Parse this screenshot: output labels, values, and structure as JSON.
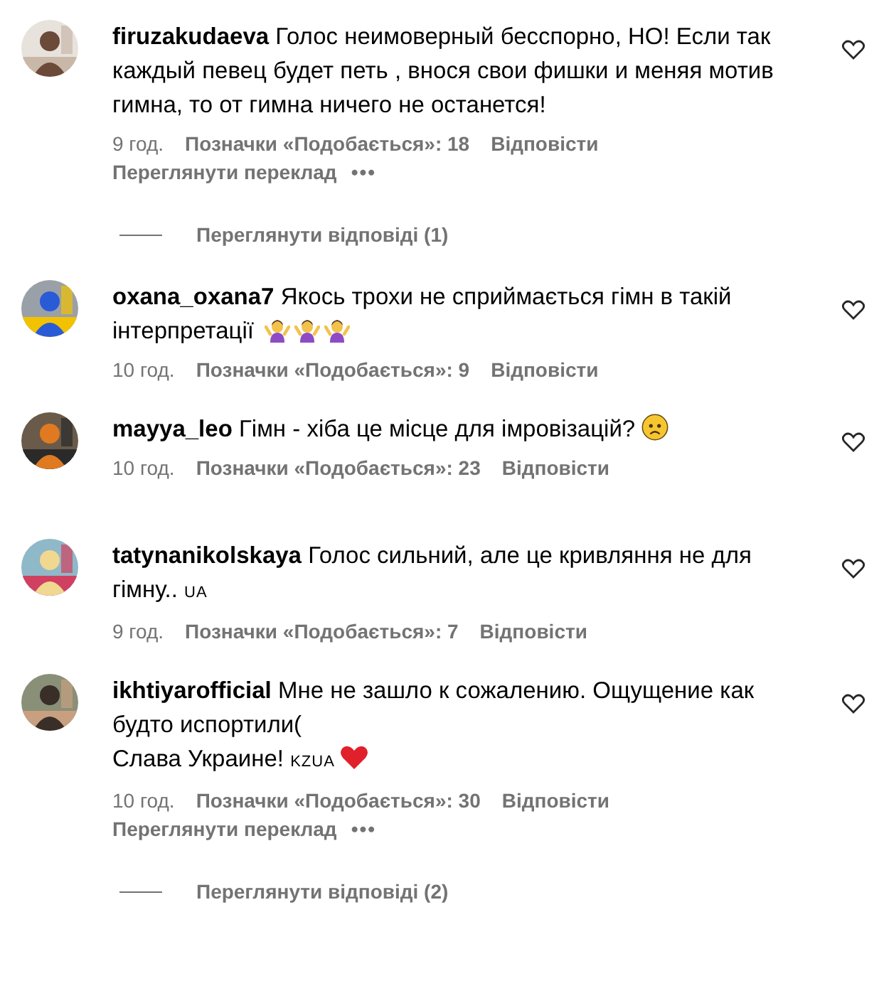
{
  "comments": [
    {
      "username": "firuzakudaeva",
      "body": "Голос неимоверный бесспорно, НО! Если так каждый певец будет петь , внося свои фишки и меняя мотив гимна, то от гимна ничего не останется!",
      "time": "9 год.",
      "likes": "Позначки «Подобається»: 18",
      "reply": "Відповісти",
      "translate": "Переглянути переклад",
      "more": "•••",
      "replies": "Переглянути відповіді (1)",
      "liked": false
    },
    {
      "username": "oxana_oxana7",
      "body": "Якось трохи не сприймається гімн в такій інтерпретації",
      "extras": [
        {
          "kind": "shrug"
        },
        {
          "kind": "shrug"
        },
        {
          "kind": "shrug"
        }
      ],
      "time": "10 год.",
      "likes": "Позначки «Подобається»: 9",
      "reply": "Відповісти",
      "liked": false
    },
    {
      "username": "mayya_leo",
      "body": "Гімн - хіба це місце для імровізацій?",
      "extras": [
        {
          "kind": "sad"
        }
      ],
      "time": "10 год.",
      "likes": "Позначки «Подобається»: 23",
      "reply": "Відповісти",
      "liked": false
    },
    {
      "username": "tatynanikolskaya",
      "body": "Голос сильний, але це кривляння не для гімну..",
      "extras": [
        {
          "kind": "flag",
          "text": "UA"
        }
      ],
      "time": "9 год.",
      "likes": "Позначки «Подобається»: 7",
      "reply": "Відповісти",
      "liked": false
    },
    {
      "username": "ikhtiyarofficial",
      "body": "Мне не зашло к сожалению. Ощущение как будто испортили(\nСлава Украине!",
      "extras": [
        {
          "kind": "flag",
          "text": "KZUA"
        },
        {
          "kind": "heart"
        }
      ],
      "time": "10 год.",
      "likes": "Позначки «Подобається»: 30",
      "reply": "Відповісти",
      "translate": "Переглянути переклад",
      "more": "•••",
      "replies": "Переглянути відповіді (2)",
      "liked": false
    }
  ]
}
